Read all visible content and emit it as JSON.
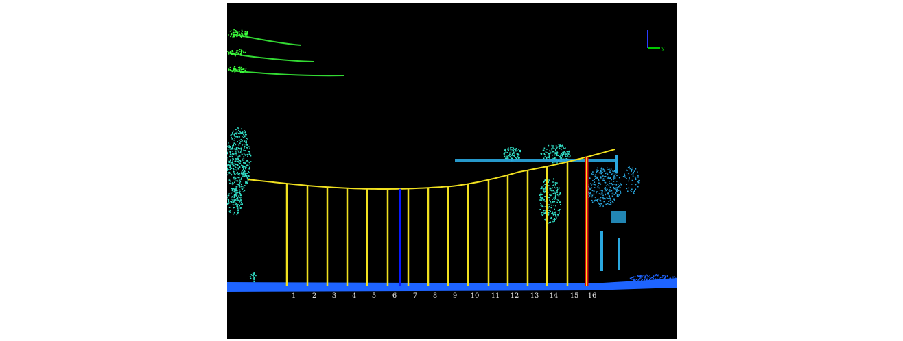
{
  "viewer": {
    "background": "#000000",
    "axes_gizmo": {
      "x_color": "#00c800",
      "z_color": "#2a3cff",
      "label": "y"
    }
  },
  "colors": {
    "line": "#f0e020",
    "highlight_blue": "#0a1aff",
    "highlight_red": "#e01010",
    "ground": "#1e64ff",
    "vegetation": "#32e0c8",
    "wires": "#3cff3c",
    "structures": "#2aa8e0"
  },
  "lines": [
    {
      "id": 1,
      "label": "1",
      "state": "normal"
    },
    {
      "id": 2,
      "label": "2",
      "state": "normal"
    },
    {
      "id": 3,
      "label": "3",
      "state": "normal"
    },
    {
      "id": 4,
      "label": "4",
      "state": "normal"
    },
    {
      "id": 5,
      "label": "5",
      "state": "normal"
    },
    {
      "id": 6,
      "label": "6",
      "state": "blue"
    },
    {
      "id": 7,
      "label": "7",
      "state": "normal"
    },
    {
      "id": 8,
      "label": "8",
      "state": "normal"
    },
    {
      "id": 9,
      "label": "9",
      "state": "normal"
    },
    {
      "id": 10,
      "label": "10",
      "state": "normal"
    },
    {
      "id": 11,
      "label": "11",
      "state": "normal"
    },
    {
      "id": 12,
      "label": "12",
      "state": "normal"
    },
    {
      "id": 13,
      "label": "13",
      "state": "normal"
    },
    {
      "id": 14,
      "label": "14",
      "state": "normal"
    },
    {
      "id": 15,
      "label": "15",
      "state": "normal"
    },
    {
      "id": 16,
      "label": "16",
      "state": "red"
    }
  ]
}
